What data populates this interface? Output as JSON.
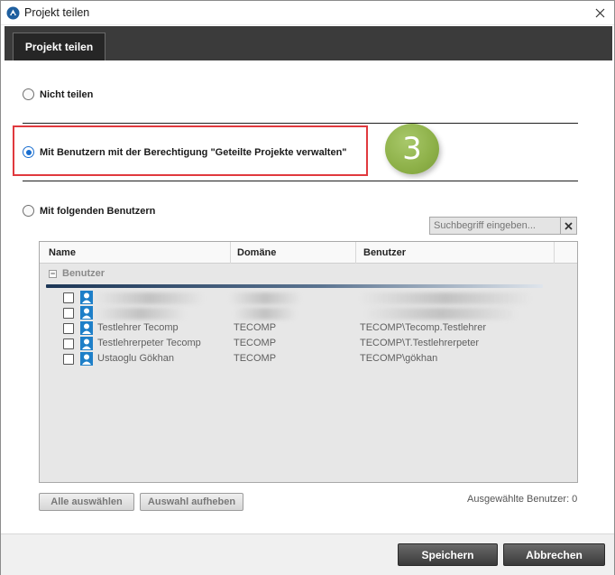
{
  "window": {
    "title": "Projekt teilen",
    "tab_label": "Projekt teilen"
  },
  "options": [
    {
      "label": "Nicht teilen",
      "checked": false
    },
    {
      "label": "Mit Benutzern mit der Berechtigung \"Geteilte Projekte verwalten\"",
      "checked": true
    },
    {
      "label": "Mit folgenden Benutzern",
      "checked": false
    }
  ],
  "annotation": {
    "step_number": "3",
    "highlight_color": "#e0393e",
    "badge_color": "#8db048"
  },
  "search": {
    "placeholder": "Suchbegriff eingeben..."
  },
  "table": {
    "columns": [
      "Name",
      "Domäne",
      "Benutzer"
    ],
    "group_label": "Benutzer",
    "rows": [
      {
        "name": "",
        "domain": "",
        "user": "",
        "redacted": true,
        "checked": false
      },
      {
        "name": "",
        "domain": "",
        "user": "",
        "redacted": true,
        "checked": false
      },
      {
        "name": "Testlehrer Tecomp",
        "domain": "TECOMP",
        "user": "TECOMP\\Tecomp.Testlehrer",
        "checked": false
      },
      {
        "name": "Testlehrerpeter Tecomp",
        "domain": "TECOMP",
        "user": "TECOMP\\T.Testlehrerpeter",
        "checked": false
      },
      {
        "name": "Ustaoglu Gökhan",
        "domain": "TECOMP",
        "user": "TECOMP\\gökhan",
        "checked": false
      }
    ]
  },
  "actions": {
    "select_all": "Alle auswählen",
    "clear_selection": "Auswahl aufheben",
    "selected_count_text": "Ausgewählte Benutzer: 0"
  },
  "footer": {
    "save": "Speichern",
    "cancel": "Abbrechen"
  },
  "colors": {
    "accent": "#1a6fd0",
    "tabbar": "#3b3b3b"
  }
}
